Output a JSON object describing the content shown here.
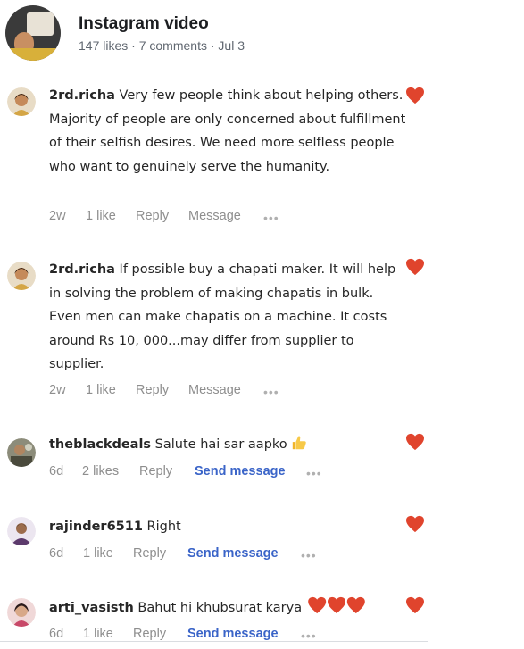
{
  "header": {
    "title": "Instagram video",
    "likes": "147 likes",
    "comments": "7 comments",
    "date": "Jul 3",
    "separator": " · "
  },
  "colors": {
    "heart": "#e0442d",
    "link": "#3a64c8",
    "muted": "#8e8e8e"
  },
  "comments": [
    {
      "user": "2rd.richa",
      "text": " Very few people think about helping others. Majority of people are only concerned about fulfillment of their selfish desires. We need more selfless people who want to genuinely serve the humanity.",
      "time": "2w",
      "likes": "1 like",
      "reply": "Reply",
      "message": "Message",
      "more": "•••"
    },
    {
      "user": "2rd.richa",
      "text": " If possible buy a chapati maker. It will help in solving the problem of making chapatis in bulk. Even men can make chapatis on a machine. It costs around Rs 10, 000...may differ from supplier to supplier.",
      "time": "2w",
      "likes": "1 like",
      "reply": "Reply",
      "message": "Message",
      "more": "•••"
    },
    {
      "user": "theblackdeals",
      "text": " Salute hai sar aapko ",
      "emoji": "thumbs-up-icon",
      "time": "6d",
      "likes": "2 likes",
      "reply": "Reply",
      "message": "Send message",
      "more": "•••"
    },
    {
      "user": "rajinder6511",
      "text": " Right",
      "time": "6d",
      "likes": "1 like",
      "reply": "Reply",
      "message": "Send message",
      "more": "•••"
    },
    {
      "user": "arti_vasisth",
      "text": " Bahut hi khubsurat karya ",
      "emoji": "three-hearts-icon",
      "time": "6d",
      "likes": "1 like",
      "reply": "Reply",
      "message": "Send message",
      "more": "•••"
    }
  ]
}
